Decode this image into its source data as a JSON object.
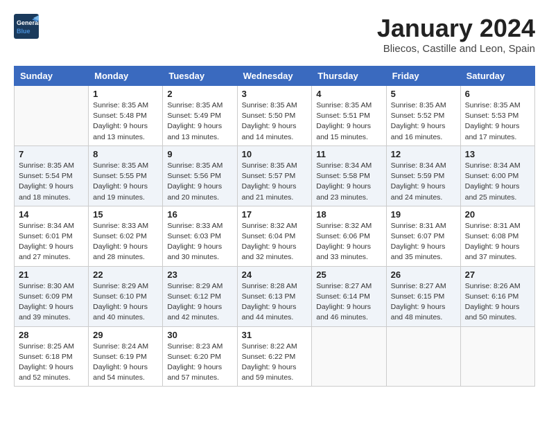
{
  "header": {
    "logo_general": "General",
    "logo_blue": "Blue",
    "month": "January 2024",
    "location": "Bliecos, Castille and Leon, Spain"
  },
  "weekdays": [
    "Sunday",
    "Monday",
    "Tuesday",
    "Wednesday",
    "Thursday",
    "Friday",
    "Saturday"
  ],
  "weeks": [
    [
      {
        "day": "",
        "info": ""
      },
      {
        "day": "1",
        "info": "Sunrise: 8:35 AM\nSunset: 5:48 PM\nDaylight: 9 hours\nand 13 minutes."
      },
      {
        "day": "2",
        "info": "Sunrise: 8:35 AM\nSunset: 5:49 PM\nDaylight: 9 hours\nand 13 minutes."
      },
      {
        "day": "3",
        "info": "Sunrise: 8:35 AM\nSunset: 5:50 PM\nDaylight: 9 hours\nand 14 minutes."
      },
      {
        "day": "4",
        "info": "Sunrise: 8:35 AM\nSunset: 5:51 PM\nDaylight: 9 hours\nand 15 minutes."
      },
      {
        "day": "5",
        "info": "Sunrise: 8:35 AM\nSunset: 5:52 PM\nDaylight: 9 hours\nand 16 minutes."
      },
      {
        "day": "6",
        "info": "Sunrise: 8:35 AM\nSunset: 5:53 PM\nDaylight: 9 hours\nand 17 minutes."
      }
    ],
    [
      {
        "day": "7",
        "info": "Sunrise: 8:35 AM\nSunset: 5:54 PM\nDaylight: 9 hours\nand 18 minutes."
      },
      {
        "day": "8",
        "info": "Sunrise: 8:35 AM\nSunset: 5:55 PM\nDaylight: 9 hours\nand 19 minutes."
      },
      {
        "day": "9",
        "info": "Sunrise: 8:35 AM\nSunset: 5:56 PM\nDaylight: 9 hours\nand 20 minutes."
      },
      {
        "day": "10",
        "info": "Sunrise: 8:35 AM\nSunset: 5:57 PM\nDaylight: 9 hours\nand 21 minutes."
      },
      {
        "day": "11",
        "info": "Sunrise: 8:34 AM\nSunset: 5:58 PM\nDaylight: 9 hours\nand 23 minutes."
      },
      {
        "day": "12",
        "info": "Sunrise: 8:34 AM\nSunset: 5:59 PM\nDaylight: 9 hours\nand 24 minutes."
      },
      {
        "day": "13",
        "info": "Sunrise: 8:34 AM\nSunset: 6:00 PM\nDaylight: 9 hours\nand 25 minutes."
      }
    ],
    [
      {
        "day": "14",
        "info": "Sunrise: 8:34 AM\nSunset: 6:01 PM\nDaylight: 9 hours\nand 27 minutes."
      },
      {
        "day": "15",
        "info": "Sunrise: 8:33 AM\nSunset: 6:02 PM\nDaylight: 9 hours\nand 28 minutes."
      },
      {
        "day": "16",
        "info": "Sunrise: 8:33 AM\nSunset: 6:03 PM\nDaylight: 9 hours\nand 30 minutes."
      },
      {
        "day": "17",
        "info": "Sunrise: 8:32 AM\nSunset: 6:04 PM\nDaylight: 9 hours\nand 32 minutes."
      },
      {
        "day": "18",
        "info": "Sunrise: 8:32 AM\nSunset: 6:06 PM\nDaylight: 9 hours\nand 33 minutes."
      },
      {
        "day": "19",
        "info": "Sunrise: 8:31 AM\nSunset: 6:07 PM\nDaylight: 9 hours\nand 35 minutes."
      },
      {
        "day": "20",
        "info": "Sunrise: 8:31 AM\nSunset: 6:08 PM\nDaylight: 9 hours\nand 37 minutes."
      }
    ],
    [
      {
        "day": "21",
        "info": "Sunrise: 8:30 AM\nSunset: 6:09 PM\nDaylight: 9 hours\nand 39 minutes."
      },
      {
        "day": "22",
        "info": "Sunrise: 8:29 AM\nSunset: 6:10 PM\nDaylight: 9 hours\nand 40 minutes."
      },
      {
        "day": "23",
        "info": "Sunrise: 8:29 AM\nSunset: 6:12 PM\nDaylight: 9 hours\nand 42 minutes."
      },
      {
        "day": "24",
        "info": "Sunrise: 8:28 AM\nSunset: 6:13 PM\nDaylight: 9 hours\nand 44 minutes."
      },
      {
        "day": "25",
        "info": "Sunrise: 8:27 AM\nSunset: 6:14 PM\nDaylight: 9 hours\nand 46 minutes."
      },
      {
        "day": "26",
        "info": "Sunrise: 8:27 AM\nSunset: 6:15 PM\nDaylight: 9 hours\nand 48 minutes."
      },
      {
        "day": "27",
        "info": "Sunrise: 8:26 AM\nSunset: 6:16 PM\nDaylight: 9 hours\nand 50 minutes."
      }
    ],
    [
      {
        "day": "28",
        "info": "Sunrise: 8:25 AM\nSunset: 6:18 PM\nDaylight: 9 hours\nand 52 minutes."
      },
      {
        "day": "29",
        "info": "Sunrise: 8:24 AM\nSunset: 6:19 PM\nDaylight: 9 hours\nand 54 minutes."
      },
      {
        "day": "30",
        "info": "Sunrise: 8:23 AM\nSunset: 6:20 PM\nDaylight: 9 hours\nand 57 minutes."
      },
      {
        "day": "31",
        "info": "Sunrise: 8:22 AM\nSunset: 6:22 PM\nDaylight: 9 hours\nand 59 minutes."
      },
      {
        "day": "",
        "info": ""
      },
      {
        "day": "",
        "info": ""
      },
      {
        "day": "",
        "info": ""
      }
    ]
  ]
}
